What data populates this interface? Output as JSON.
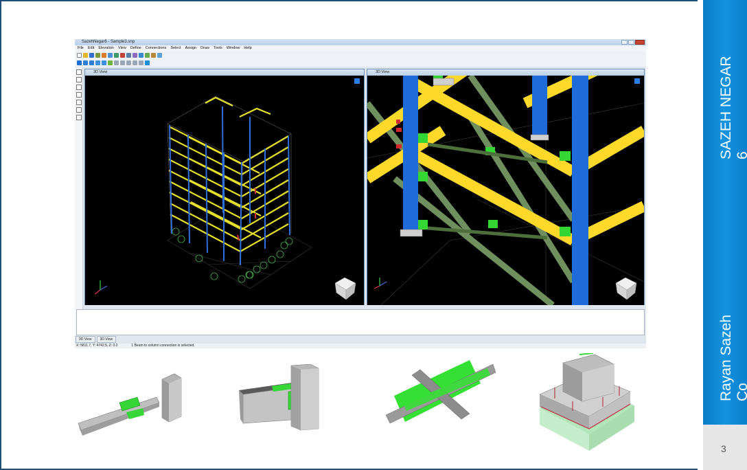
{
  "slide": {
    "vertical_title": "SAZEH NEGAR",
    "vertical_title_suffix": "6",
    "vertical_subtitle": "Rayan Sazeh",
    "vertical_subtitle_suffix": "Co",
    "page_number": "3",
    "colors": {
      "accent": "#1293e0",
      "frame": "#1f4e79",
      "footer": "#e6e6e6"
    }
  },
  "app": {
    "window_title": "SazehNegar6 - Sample3.snp",
    "menu": [
      "File",
      "Edit",
      "Elevation",
      "View",
      "Define",
      "Connections",
      "Select",
      "Assign",
      "Draw",
      "Tools",
      "Window",
      "Help"
    ],
    "viewports": [
      {
        "title": "3D View"
      },
      {
        "title": "3D View"
      }
    ],
    "bottom_tabs": [
      "3D View",
      "3D View"
    ],
    "status": {
      "coordinates": "X: 5811.7, Y: 4742.5, Z: 0.0",
      "message": "1 Beam to column connection is selected."
    }
  },
  "thumbnails": [
    {
      "icon": "beam-to-column-connection-icon"
    },
    {
      "icon": "beam-splice-connection-icon"
    },
    {
      "icon": "bracing-cross-connection-icon"
    },
    {
      "icon": "base-plate-pedestal-icon"
    }
  ]
}
